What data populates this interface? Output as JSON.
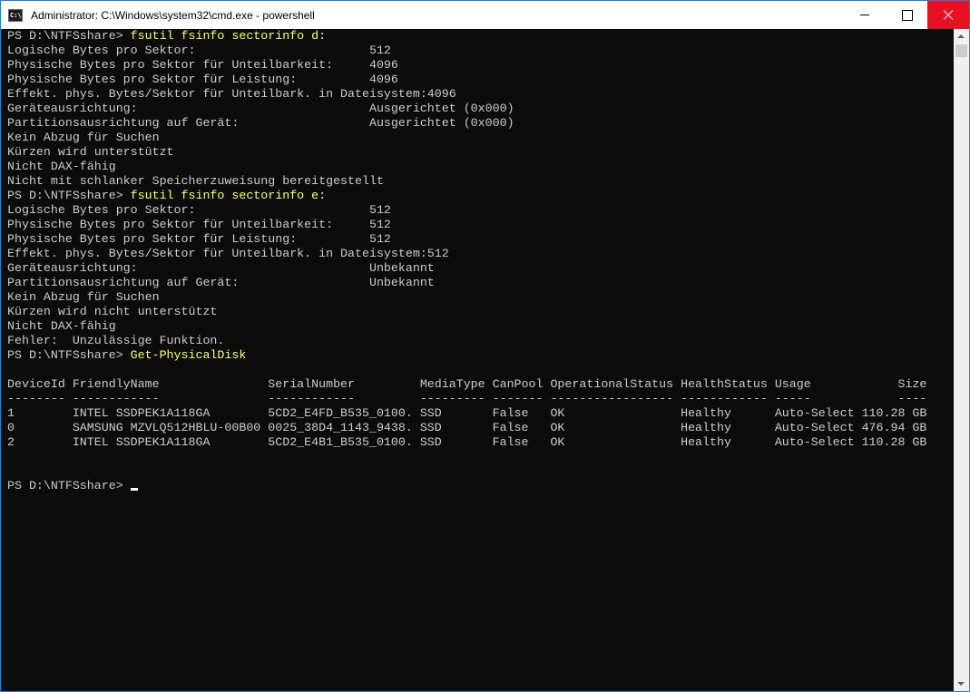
{
  "window": {
    "title": "Administrator: C:\\Windows\\system32\\cmd.exe - powershell",
    "icon": "cmd-icon",
    "app_icon_text": "C:\\",
    "accent_color": "#1883d7",
    "close_color": "#e81123"
  },
  "console": {
    "background": "#0c0c0c",
    "foreground": "#cccccc",
    "command_color": "#ffff66",
    "lines": [
      {
        "prompt": "PS D:\\NTFSshare> ",
        "command": "fsutil fsinfo sectorinfo d:"
      },
      {
        "text": "Logische Bytes pro Sektor:                        512"
      },
      {
        "text": "Physische Bytes pro Sektor für Unteilbarkeit:     4096"
      },
      {
        "text": "Physische Bytes pro Sektor für Leistung:          4096"
      },
      {
        "text": "Effekt. phys. Bytes/Sektor für Unteilbark. in Dateisystem:4096"
      },
      {
        "text": "Geräteausrichtung:                                Ausgerichtet (0x000)"
      },
      {
        "text": "Partitionsausrichtung auf Gerät:                  Ausgerichtet (0x000)"
      },
      {
        "text": "Kein Abzug für Suchen"
      },
      {
        "text": "Kürzen wird unterstützt"
      },
      {
        "text": "Nicht DAX-fähig"
      },
      {
        "text": "Nicht mit schlanker Speicherzuweisung bereitgestellt"
      },
      {
        "prompt": "PS D:\\NTFSshare> ",
        "command": "fsutil fsinfo sectorinfo e:"
      },
      {
        "text": "Logische Bytes pro Sektor:                        512"
      },
      {
        "text": "Physische Bytes pro Sektor für Unteilbarkeit:     512"
      },
      {
        "text": "Physische Bytes pro Sektor für Leistung:          512"
      },
      {
        "text": "Effekt. phys. Bytes/Sektor für Unteilbark. in Dateisystem:512"
      },
      {
        "text": "Geräteausrichtung:                                Unbekannt"
      },
      {
        "text": "Partitionsausrichtung auf Gerät:                  Unbekannt"
      },
      {
        "text": "Kein Abzug für Suchen"
      },
      {
        "text": "Kürzen wird nicht unterstützt"
      },
      {
        "text": "Nicht DAX-fähig"
      },
      {
        "text": "Fehler:  Unzulässige Funktion."
      },
      {
        "prompt": "PS D:\\NTFSshare> ",
        "command": "Get-PhysicalDisk"
      },
      {
        "text": ""
      },
      {
        "text": "DeviceId FriendlyName               SerialNumber         MediaType CanPool OperationalStatus HealthStatus Usage            Size"
      },
      {
        "text": "-------- ------------               ------------         --------- ------- ----------------- ------------ -----            ----"
      },
      {
        "text": "1        INTEL SSDPEK1A118GA        5CD2_E4FD_B535_0100. SSD       False   OK                Healthy      Auto-Select 110.28 GB"
      },
      {
        "text": "0        SAMSUNG MZVLQ512HBLU-00B00 0025_38D4_1143_9438. SSD       False   OK                Healthy      Auto-Select 476.94 GB"
      },
      {
        "text": "2        INTEL SSDPEK1A118GA        5CD2_E4B1_B535_0100. SSD       False   OK                Healthy      Auto-Select 110.28 GB"
      },
      {
        "text": ""
      },
      {
        "text": ""
      },
      {
        "prompt": "PS D:\\NTFSshare> ",
        "command": "",
        "cursor": true
      }
    ]
  }
}
